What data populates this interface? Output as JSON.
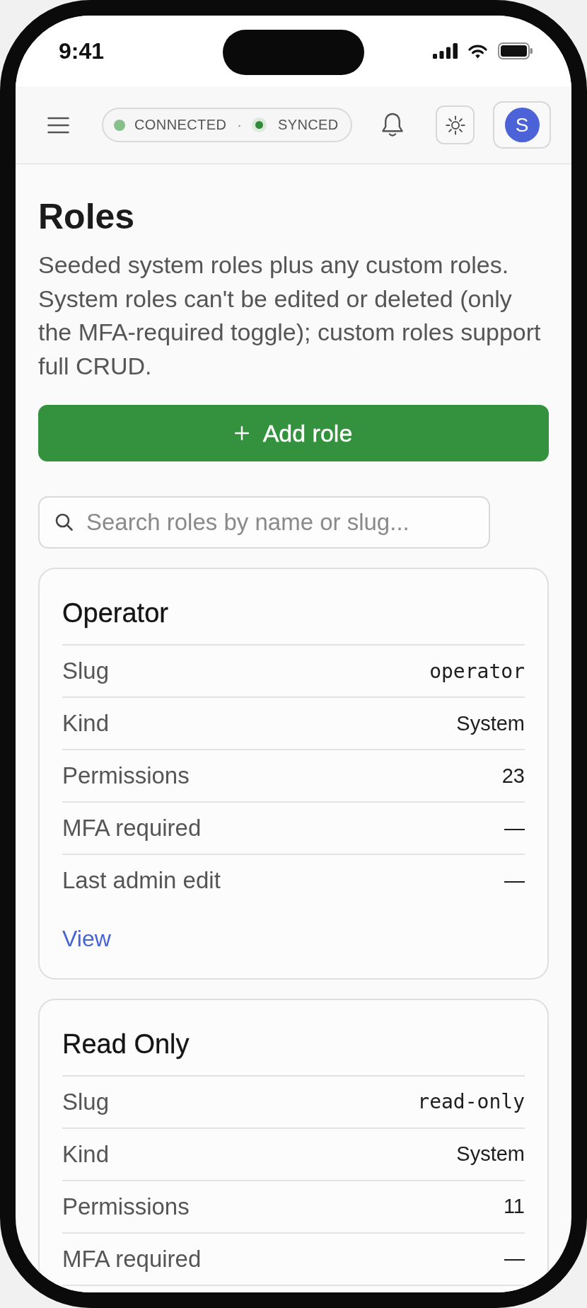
{
  "status_bar": {
    "time": "9:41"
  },
  "top_bar": {
    "status": [
      {
        "label": "CONNECTED",
        "kind": "dot",
        "color": "#86c08a"
      },
      {
        "label": "SYNCED",
        "kind": "ring",
        "color": "#2e8b3a"
      }
    ],
    "separator": "·",
    "avatar": "S"
  },
  "page": {
    "title": "Roles",
    "description": "Seeded system roles plus any custom roles. System roles can't be edited or deleted (only the MFA-required toggle); custom roles support full CRUD.",
    "add_button": "Add role",
    "search": {
      "placeholder": "Search roles by name or slug..."
    }
  },
  "roles": [
    {
      "name": "Operator",
      "fields": [
        {
          "label": "Slug",
          "value": "operator",
          "kind": "mono"
        },
        {
          "label": "Kind",
          "value": "System",
          "kind": "text"
        },
        {
          "label": "Permissions",
          "value": "23",
          "kind": "text"
        },
        {
          "label": "MFA required",
          "value": "—",
          "kind": "text"
        },
        {
          "label": "Last admin edit",
          "value": "—",
          "kind": "text"
        }
      ],
      "link": "View"
    },
    {
      "name": "Read Only",
      "fields": [
        {
          "label": "Slug",
          "value": "read-only",
          "kind": "mono"
        },
        {
          "label": "Kind",
          "value": "System",
          "kind": "text"
        },
        {
          "label": "Permissions",
          "value": "11",
          "kind": "text"
        },
        {
          "label": "MFA required",
          "value": "—",
          "kind": "text"
        }
      ]
    }
  ]
}
